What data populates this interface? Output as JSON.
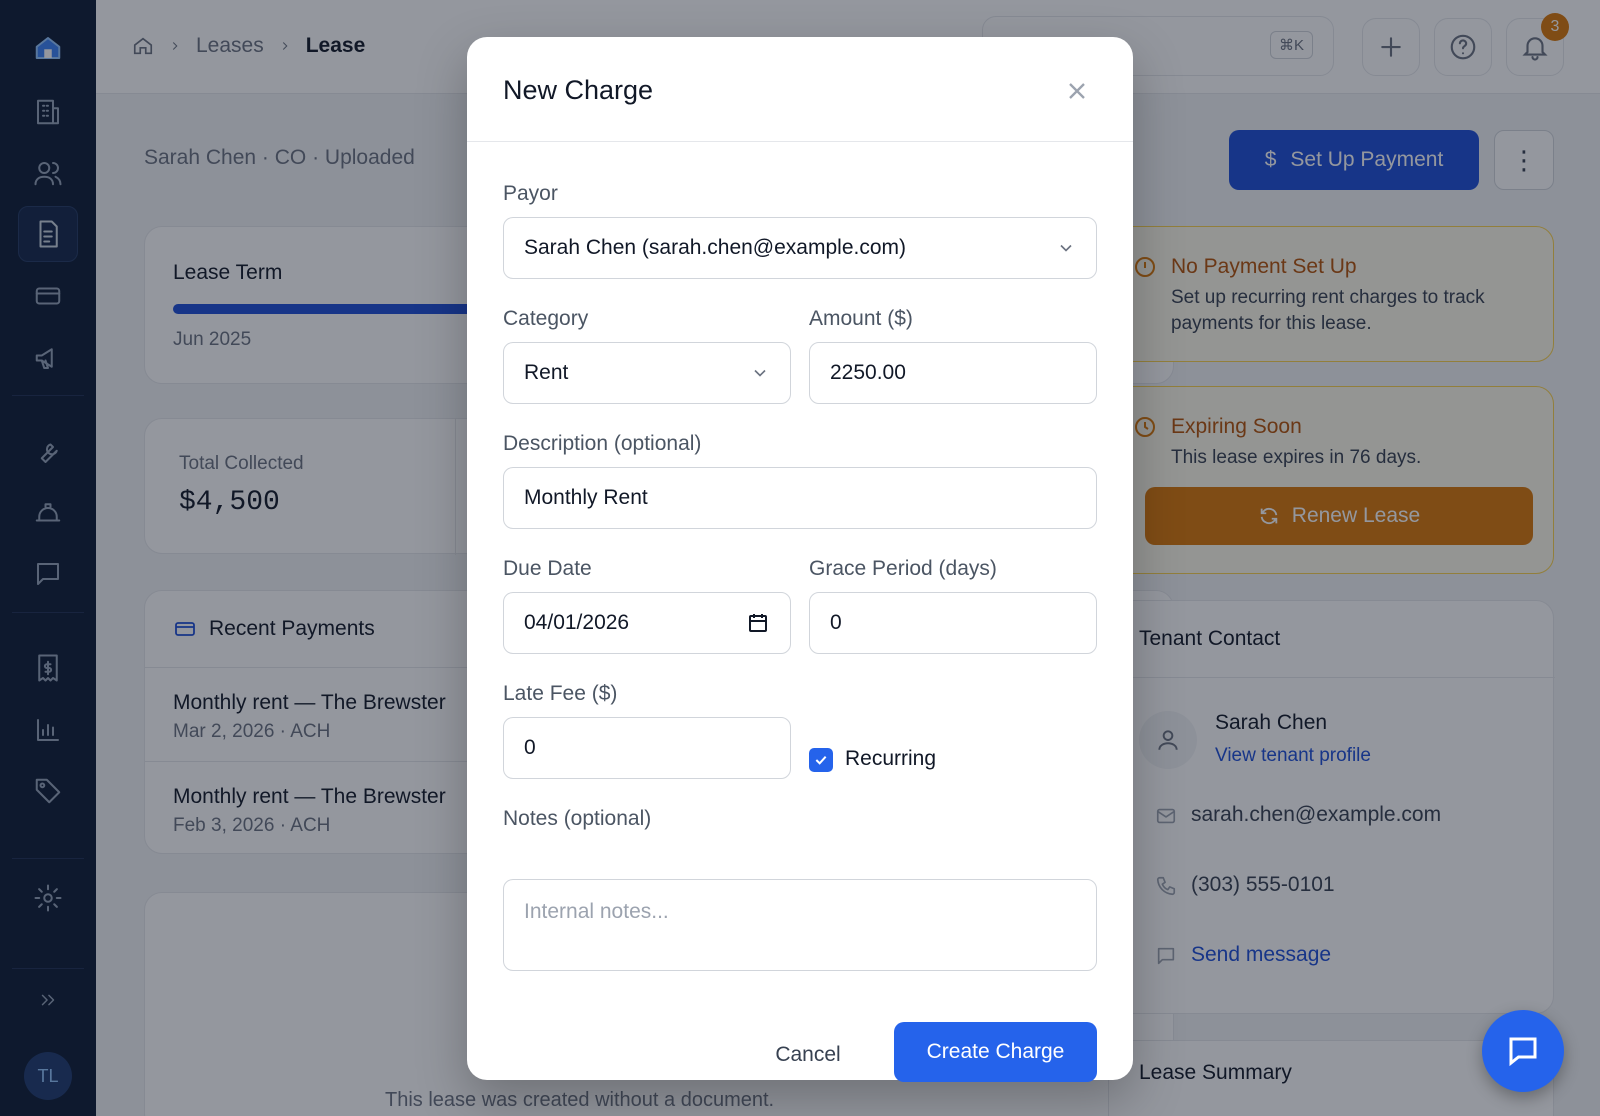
{
  "breadcrumbs": {
    "leases": "Leases",
    "current": "Lease"
  },
  "search": {
    "shortcut": "⌘K"
  },
  "notifications": {
    "count": "3"
  },
  "user": {
    "initials": "TL"
  },
  "page": {
    "subtitle": "Sarah Chen · CO · Uploaded"
  },
  "actions": {
    "setup_payment": "Set Up Payment",
    "more": "⋮"
  },
  "lease_term": {
    "title": "Lease Term",
    "start": "Jun 2025"
  },
  "stats": {
    "total_collected_label": "Total Collected",
    "total_collected_value": "$4,500"
  },
  "recent_payments": {
    "title": "Recent Payments",
    "items": [
      {
        "title": "Monthly rent — The Brewster",
        "date": "Mar 2, 2026",
        "method": "ACH"
      },
      {
        "title": "Monthly rent — The Brewster",
        "date": "Feb 3, 2026",
        "method": "ACH"
      }
    ]
  },
  "document_note": "This lease was created without a document.",
  "alerts": {
    "no_payment": {
      "title": "No Payment Set Up",
      "body_line1": "Set up recurring rent charges to track",
      "body_line2": "payments for this lease."
    },
    "expiring": {
      "title": "Expiring Soon",
      "body": "This lease expires in 76 days.",
      "button": "Renew Lease"
    }
  },
  "tenant_contact": {
    "title": "Tenant Contact",
    "name": "Sarah Chen",
    "profile_link": "View tenant profile",
    "email": "sarah.chen@example.com",
    "phone": "(303) 555-0101",
    "message_link": "Send message"
  },
  "lease_summary": {
    "title": "Lease Summary"
  },
  "modal": {
    "title": "New Charge",
    "payor_label": "Payor",
    "payor_value": "Sarah Chen (sarah.chen@example.com)",
    "category_label": "Category",
    "category_value": "Rent",
    "amount_label": "Amount ($)",
    "amount_value": "2250.00",
    "description_label": "Description (optional)",
    "description_value": "Monthly Rent",
    "due_date_label": "Due Date",
    "due_date_value": "04/01/2026",
    "grace_label": "Grace Period (days)",
    "grace_value": "0",
    "late_fee_label": "Late Fee ($)",
    "late_fee_value": "0",
    "recurring_label": "Recurring",
    "recurring_checked": true,
    "notes_label": "Notes (optional)",
    "notes_placeholder": "Internal notes...",
    "cancel": "Cancel",
    "create": "Create Charge"
  },
  "colors": {
    "primary": "#2563eb",
    "sidebar": "#0c1a33",
    "warning": "#d97706"
  }
}
